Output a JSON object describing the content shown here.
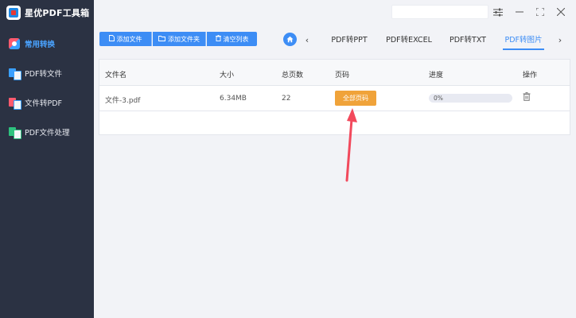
{
  "app": {
    "title": "星优PDF工具箱"
  },
  "sidebar": {
    "items": [
      {
        "label": "常用转换",
        "active": true,
        "icon": "home-icon"
      },
      {
        "label": "PDF转文件",
        "active": false,
        "icon": "pdf-to-file-icon"
      },
      {
        "label": "文件转PDF",
        "active": false,
        "icon": "file-to-pdf-icon"
      },
      {
        "label": "PDF文件处理",
        "active": false,
        "icon": "pdf-process-icon"
      }
    ]
  },
  "toolbar": {
    "add_file": "添加文件",
    "add_folder": "添加文件夹",
    "clear_list": "清空列表"
  },
  "tabs": [
    {
      "label": "PDF转PPT",
      "active": false
    },
    {
      "label": "PDF转EXCEL",
      "active": false
    },
    {
      "label": "PDF转TXT",
      "active": false
    },
    {
      "label": "PDF转图片",
      "active": true
    }
  ],
  "table": {
    "headers": [
      "文件名",
      "大小",
      "总页数",
      "页码",
      "进度",
      "操作"
    ],
    "rows": [
      {
        "filename": "文件-3.pdf",
        "size": "6.34MB",
        "pages": "22",
        "page_button": "全部页码",
        "progress": "0%",
        "progress_fraction": 0
      }
    ]
  },
  "colors": {
    "accent": "#3d8df5",
    "sidebar": "#2b3243",
    "orange": "#f0a33a",
    "annotation": "#f2495c"
  },
  "icons": {
    "settings": "sliders-icon",
    "minimize": "minimize-icon",
    "maximize": "maximize-icon",
    "close": "close-icon"
  }
}
